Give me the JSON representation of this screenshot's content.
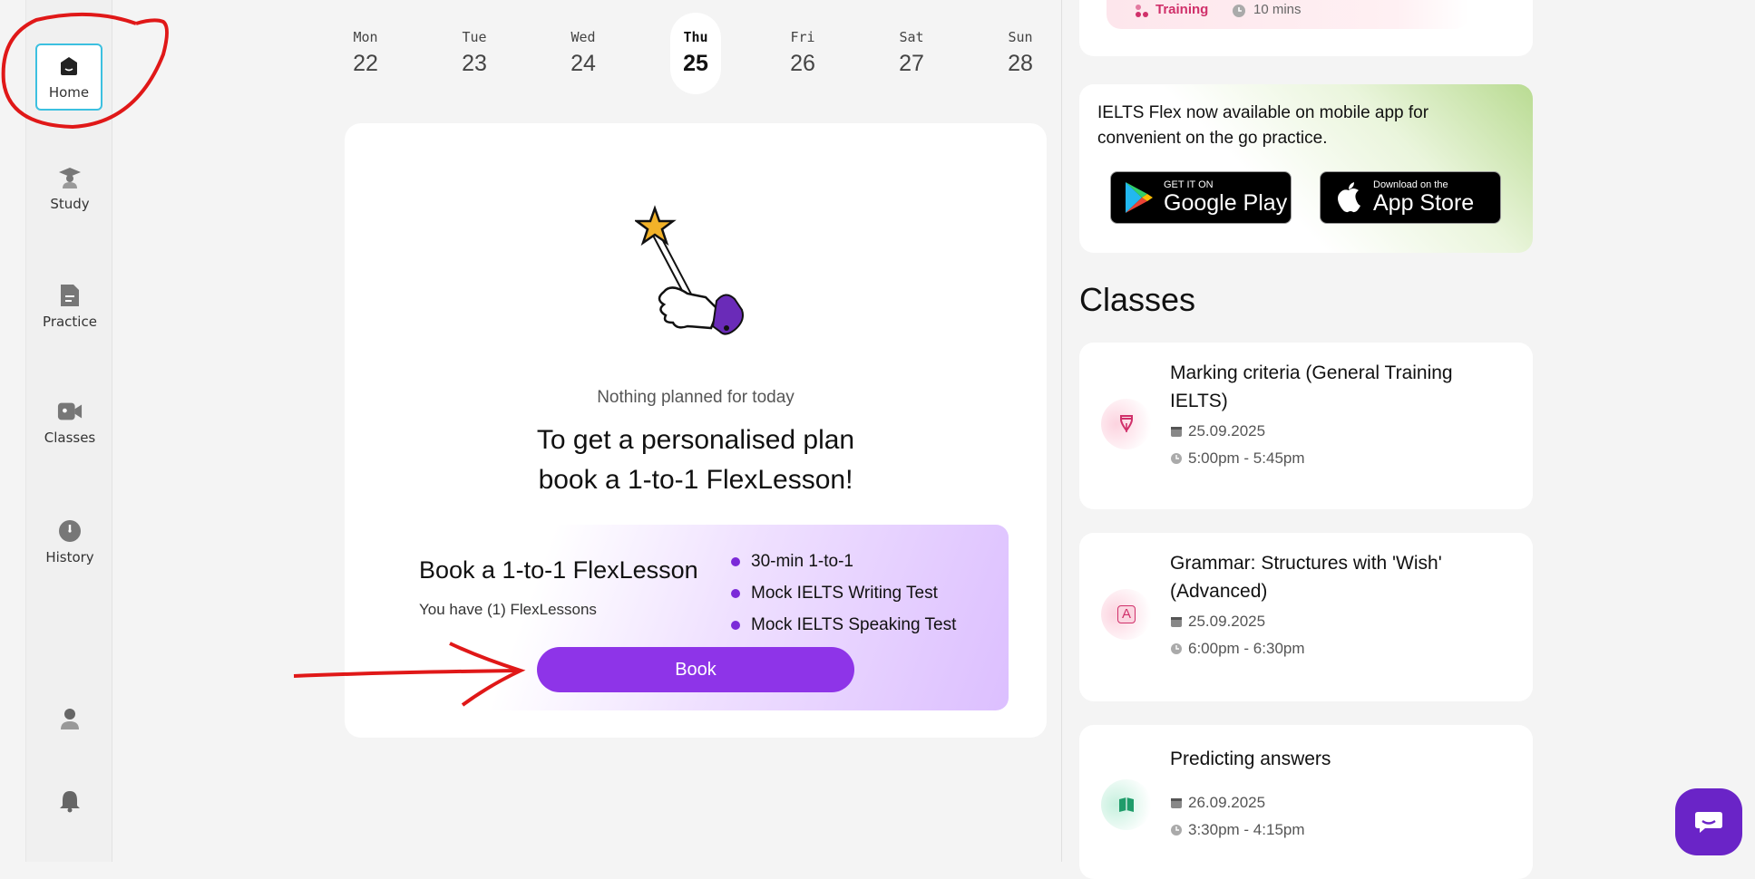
{
  "sidebar": {
    "items": [
      {
        "label": "Home",
        "icon": "home-icon",
        "active": true
      },
      {
        "label": "Study",
        "icon": "graduation-cap-icon"
      },
      {
        "label": "Practice",
        "icon": "document-icon"
      },
      {
        "label": "Classes",
        "icon": "video-camera-icon"
      },
      {
        "label": "History",
        "icon": "clock-icon"
      }
    ],
    "profile_icon": "user-icon",
    "notifications_icon": "bell-icon"
  },
  "week": {
    "days": [
      {
        "name": "Mon",
        "num": "22"
      },
      {
        "name": "Tue",
        "num": "23"
      },
      {
        "name": "Wed",
        "num": "24"
      },
      {
        "name": "Thu",
        "num": "25",
        "today": true
      },
      {
        "name": "Fri",
        "num": "26"
      },
      {
        "name": "Sat",
        "num": "27"
      },
      {
        "name": "Sun",
        "num": "28"
      }
    ]
  },
  "today": {
    "nothing_text": "Nothing planned for today",
    "promo_line1": "To get a personalised plan",
    "promo_line2": "book a 1-to-1 FlexLesson!"
  },
  "booking": {
    "title": "Book a 1-to-1 FlexLesson",
    "subtitle": "You have (1) FlexLessons",
    "features": [
      "30-min 1-to-1",
      "Mock IELTS Writing Test",
      "Mock IELTS Speaking Test"
    ],
    "button_label": "Book",
    "accent_color": "#8e34e8"
  },
  "top_card": {
    "tag": "Training",
    "duration": "10 mins"
  },
  "app_promo": {
    "text": "IELTS Flex now available on mobile app for convenient on the go practice.",
    "google_small": "GET IT ON",
    "google_big": "Google Play",
    "apple_small": "Download on the",
    "apple_big": "App Store"
  },
  "classes": {
    "title": "Classes",
    "items": [
      {
        "name": "Marking criteria (General Training IELTS)",
        "date": "25.09.2025",
        "time": "5:00pm - 5:45pm",
        "icon": "fountain-pen-icon",
        "color": "#fde3ea"
      },
      {
        "name": "Grammar: Structures with 'Wish' (Advanced)",
        "date": "25.09.2025",
        "time": "6:00pm - 6:30pm",
        "icon": "letter-a-icon",
        "color": "#fde3ea",
        "glyph": "A"
      },
      {
        "name": "Predicting answers",
        "date": "26.09.2025",
        "time": "3:30pm - 4:15pm",
        "icon": "book-icon",
        "color": "#d8f5ea"
      }
    ]
  }
}
